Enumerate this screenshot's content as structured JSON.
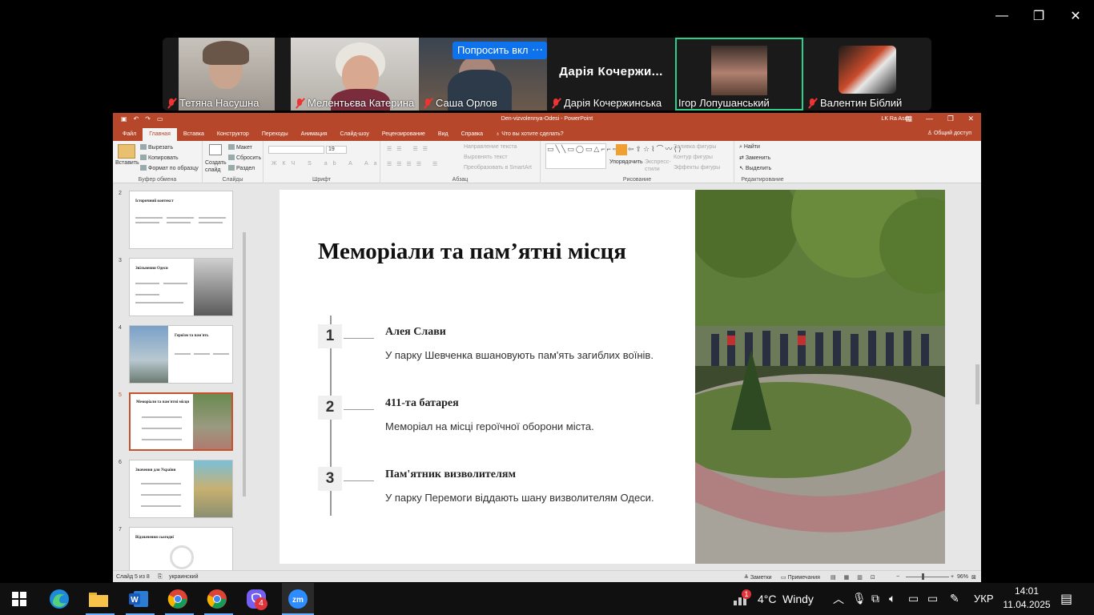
{
  "zoom": {
    "ask_button": "Попросить вкл",
    "more_button": "···",
    "participants": [
      {
        "name": "Тетяна Насушна",
        "muted": true
      },
      {
        "name": "Мелентьєва Катерина",
        "muted": true
      },
      {
        "name": "Саша Орлов",
        "muted": true
      },
      {
        "name": "Дарія Кочержинська",
        "muted": true,
        "big_name": "Дарія Кочержи..."
      },
      {
        "name": "Ігор Лопушанський",
        "muted": false,
        "active": true
      },
      {
        "name": "Валентин Біблий",
        "muted": true
      }
    ],
    "window_buttons": [
      "—",
      "❐",
      "✕"
    ]
  },
  "ppt": {
    "file_name": "Den-vizvolennya-Odesi  -  PowerPoint",
    "user": "LK Ra Asdtj",
    "tabs": [
      "Файл",
      "Главная",
      "Вставка",
      "Конструктор",
      "Переходы",
      "Анимация",
      "Слайд-шоу",
      "Рецензирование",
      "Вид",
      "Справка",
      "Что вы хотите сделать?"
    ],
    "share": "Общий доступ",
    "ribbon": {
      "paste": "Вставить",
      "cut": "Вырезать",
      "copy": "Копировать",
      "format_painter": "Формат по образцу",
      "clipboard": "Буфер обмена",
      "new_slide": "Создать слайд",
      "layout": "Макет",
      "reset": "Сбросить",
      "section": "Раздел",
      "slides": "Слайды",
      "font": "Шрифт",
      "font_size": "19",
      "paragraph": "Абзац",
      "text_direction": "Направление текста",
      "align_text": "Выровнять текст",
      "smartart": "Преобразовать в SmartArt",
      "arrange": "Упорядочить",
      "quick_styles": "Экспресс-стили",
      "shape_fill": "Заливка фигуры",
      "shape_outline": "Контур фигуры",
      "shape_effects": "Эффекты фигуры",
      "drawing": "Рисование",
      "find": "Найти",
      "replace": "Заменить",
      "select": "Выделить",
      "editing": "Редактирование"
    },
    "thumbnails": [
      {
        "num": "2",
        "title": "Історичний контекст"
      },
      {
        "num": "3",
        "title": "Звільнення Одеси"
      },
      {
        "num": "4",
        "title": "Героїзм та пам'ять"
      },
      {
        "num": "5",
        "title": "Меморіали та пам'ятні місця"
      },
      {
        "num": "6",
        "title": "Значення для України"
      },
      {
        "num": "7",
        "title": "Відзначення сьогодні"
      }
    ],
    "slide": {
      "title": "Меморіали та пам’ятні місця",
      "items": [
        {
          "num": "1",
          "head": "Алея Слави",
          "text": "У парку Шевченка вшановують пам'ять загиблих воїнів."
        },
        {
          "num": "2",
          "head": "411-та батарея",
          "text": "Меморіал на місці героїчної оборони міста."
        },
        {
          "num": "3",
          "head": "Пам'ятник визволителям",
          "text": "У парку Перемоги віддають шану визволителям Одеси."
        }
      ]
    },
    "status": {
      "slide_counter": "Слайд 5 из 8",
      "language": "украинский",
      "notes": "Заметки",
      "comments": "Примечания",
      "zoom": "96%"
    }
  },
  "taskbar": {
    "weather_temp": "4°C",
    "weather_text": "Windy",
    "weather_badge": "1",
    "viber_badge": "4",
    "lang": "УКР",
    "time": "14:01",
    "date": "11.04.2025"
  }
}
